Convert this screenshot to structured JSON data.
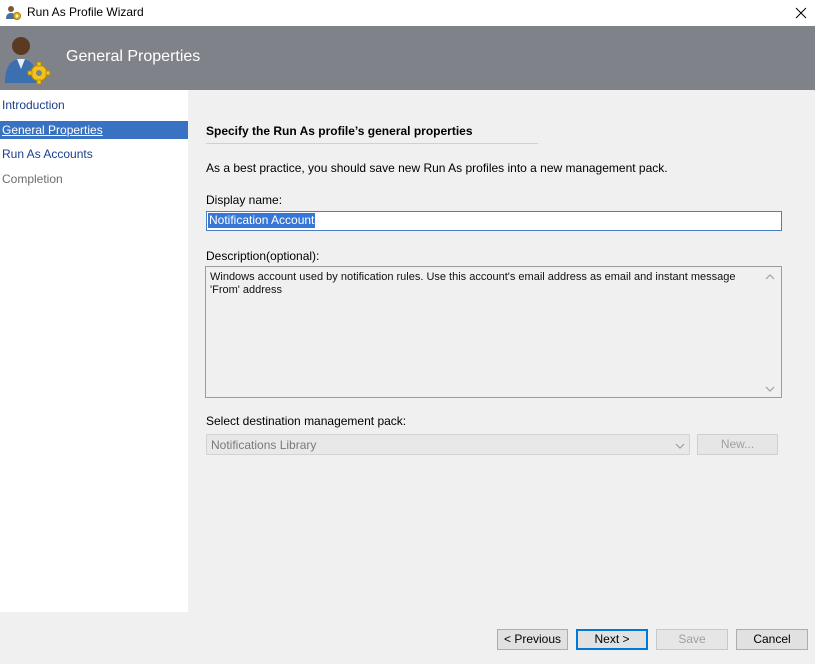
{
  "window": {
    "title": "Run As Profile Wizard",
    "close_icon": "close-icon",
    "app_icon": "run-as-profile-icon"
  },
  "banner": {
    "heading": "General Properties",
    "icon": "user-gear-icon"
  },
  "nav": {
    "items": [
      {
        "label": "Introduction",
        "state": "link"
      },
      {
        "label": "General Properties",
        "state": "selected"
      },
      {
        "label": "Run As Accounts",
        "state": "link"
      },
      {
        "label": "Completion",
        "state": "disabled"
      }
    ]
  },
  "form": {
    "section_title": "Specify the Run As profile’s general properties",
    "info": "As a best practice, you should save new Run As profiles into a new management pack.",
    "display_name_label": "Display name:",
    "display_name_value": "Notification Account",
    "description_label": "Description(optional):",
    "description_value": "Windows account used by notification rules. Use this account's email address as email and instant message 'From' address",
    "mp_label": "Select destination management pack:",
    "mp_value": "Notifications Library",
    "new_button": "New..."
  },
  "footer": {
    "previous": "< Previous",
    "next": "Next >",
    "save": "Save",
    "cancel": "Cancel"
  },
  "colors": {
    "banner": "#7f8289",
    "selection": "#3a72c3",
    "content_bg": "#f0f0f0",
    "link": "#1a3f8a"
  }
}
